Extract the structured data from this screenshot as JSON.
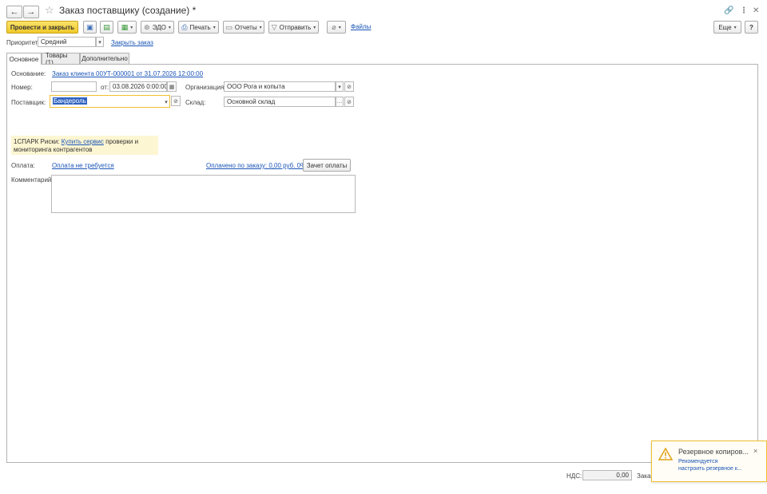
{
  "window": {
    "title": "Заказ поставщику (создание) *"
  },
  "toolbar": {
    "post_close": "Провести и закрыть",
    "edo": "ЭДО",
    "print": "Печать",
    "reports": "Отчеты",
    "send": "Отправить",
    "files": "Файлы",
    "more": "Еще",
    "help": "?"
  },
  "header": {
    "priority_label": "Приоритет:",
    "priority_value": "Средний",
    "close_order": "Закрыть заказ"
  },
  "tabs": [
    {
      "label": "Основное"
    },
    {
      "label": "Товары (1)"
    },
    {
      "label": "Дополнительно"
    }
  ],
  "main": {
    "basis_label": "Основание:",
    "basis_value": "Заказ клиента 00УТ-000001 от 31.07.2026 12:00:00",
    "number_label": "Номер:",
    "number_value": "",
    "date_label": "от:",
    "date_value": "03.08.2026  0:00:00",
    "org_label": "Организация:",
    "org_value": "ООО Рога и копыта",
    "supplier_label": "Поставщик:",
    "supplier_value": "Бандероль",
    "warehouse_label": "Склад:",
    "warehouse_value": "Основной склад",
    "spark_prefix": "1СПАРК Риски:",
    "spark_link": "Купить сервис",
    "spark_line1_rest": "проверки и",
    "spark_line2": "мониторинга контрагентов",
    "payment_label": "Оплата:",
    "payment_value": "Оплата не требуется",
    "paid_link": "Оплачено по заказу: 0,00 руб. 0%",
    "offset_button": "Зачет оплаты",
    "comment_label": "Комментарий:",
    "comment_value": ""
  },
  "footer": {
    "vat_label": "НДС:",
    "vat_value": "0,00",
    "order_label": "Заказ"
  },
  "notification": {
    "title": "Резервное копиров...",
    "line1": "Рекомендуется",
    "line2": "настроить резервное к...",
    "close": "×"
  },
  "colors": {
    "accent_yellow": "#f0c92a",
    "link_blue": "#1a55b8",
    "focus_border": "#f1c030",
    "spark_bg": "#fdf6d2"
  }
}
